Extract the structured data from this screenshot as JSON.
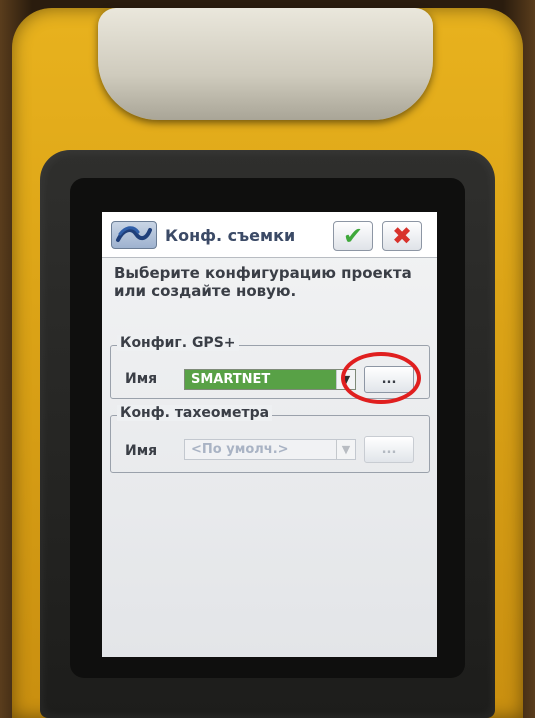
{
  "window": {
    "title": "Конф. съемки",
    "app_icon": "trimble-logo-icon",
    "ok_icon": "checkmark-icon",
    "ok_glyph": "✔",
    "cancel_icon": "close-x-icon",
    "cancel_glyph": "✖"
  },
  "instruction": "Выберите конфигурацию проекта или создайте новую.",
  "gps_group": {
    "legend": "Конфиг. GPS+",
    "name_label": "Имя",
    "selected_value": "SMARTNET",
    "browse_label": "..."
  },
  "ts_group": {
    "legend": "Конф. тахеометра",
    "name_label": "Имя",
    "selected_value": "<По умолч.>",
    "browse_label": "..."
  },
  "colors": {
    "device_yellow": "#dca417",
    "selection_green": "#58a146",
    "annotation_red": "#e01f1f",
    "ok_green": "#3fa83b",
    "cancel_red": "#d8322c"
  }
}
